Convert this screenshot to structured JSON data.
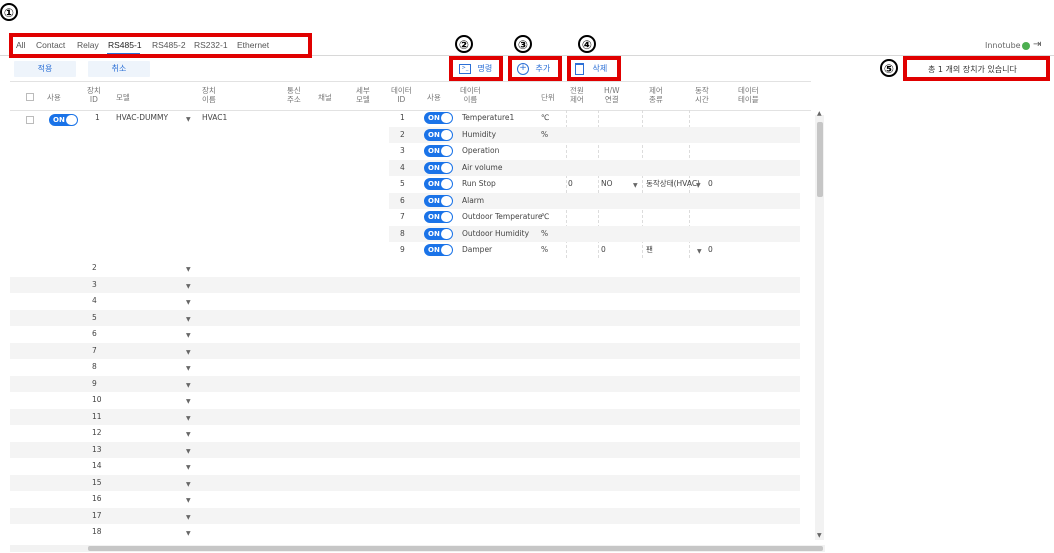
{
  "callouts": [
    "①",
    "②",
    "③",
    "④",
    "⑤"
  ],
  "tabs": [
    "All",
    "Contact",
    "Relay",
    "RS485-1",
    "RS485-2",
    "RS232-1",
    "Ethernet"
  ],
  "brand": "Innotube",
  "buttons": {
    "apply": "적용",
    "cancel": "취소",
    "command": "명령",
    "add": "추가",
    "delete": "삭제"
  },
  "status_text": "총 1 개의 장치가 있습니다",
  "headers": {
    "use": "사용",
    "device_id": "장치\nID",
    "model": "모델",
    "device_name": "장치\n이름",
    "comm_addr": "통신\n주소",
    "channel": "채널",
    "sub_model": "세부\n모델",
    "data_id": "데이터\nID",
    "use2": "사용",
    "data_name": "데이터\n이름",
    "unit": "단위",
    "power_control": "전원\n제어",
    "hw_conn": "H/W\n연결",
    "control_type": "제어\n종류",
    "action_time": "동작\n시간",
    "data_table": "데이터\n테이블"
  },
  "device": {
    "id": "1",
    "model": "HVAC-DUMMY",
    "name": "HVAC1",
    "toggle": "ON"
  },
  "data_rows": [
    {
      "id": "1",
      "name": "Temperature1",
      "unit": "℃",
      "power": "",
      "hw": "",
      "ctrl": "",
      "time": ""
    },
    {
      "id": "2",
      "name": "Humidity",
      "unit": "%",
      "power": "",
      "hw": "",
      "ctrl": "",
      "time": ""
    },
    {
      "id": "3",
      "name": "Operation",
      "unit": "",
      "power": "",
      "hw": "",
      "ctrl": "",
      "time": ""
    },
    {
      "id": "4",
      "name": "Air volume",
      "unit": "",
      "power": "",
      "hw": "",
      "ctrl": "",
      "time": ""
    },
    {
      "id": "5",
      "name": "Run Stop",
      "unit": "",
      "power": "0",
      "hw": "NO",
      "ctrl": "동작상태(HVAC)",
      "time": "0"
    },
    {
      "id": "6",
      "name": "Alarm",
      "unit": "",
      "power": "",
      "hw": "",
      "ctrl": "",
      "time": ""
    },
    {
      "id": "7",
      "name": "Outdoor Temperature",
      "unit": "℃",
      "power": "",
      "hw": "",
      "ctrl": "",
      "time": ""
    },
    {
      "id": "8",
      "name": "Outdoor Humidity",
      "unit": "%",
      "power": "",
      "hw": "",
      "ctrl": "",
      "time": ""
    },
    {
      "id": "9",
      "name": "Damper",
      "unit": "%",
      "power": "",
      "hw": "0",
      "ctrl": "팬",
      "time": "0"
    }
  ],
  "empty_ids": [
    "2",
    "3",
    "4",
    "5",
    "6",
    "7",
    "8",
    "9",
    "10",
    "11",
    "12",
    "13",
    "14",
    "15",
    "16",
    "17",
    "18"
  ],
  "colors": {
    "accent": "#1a73e8",
    "highlight": "#e00000",
    "status_led": "#4caf50"
  }
}
